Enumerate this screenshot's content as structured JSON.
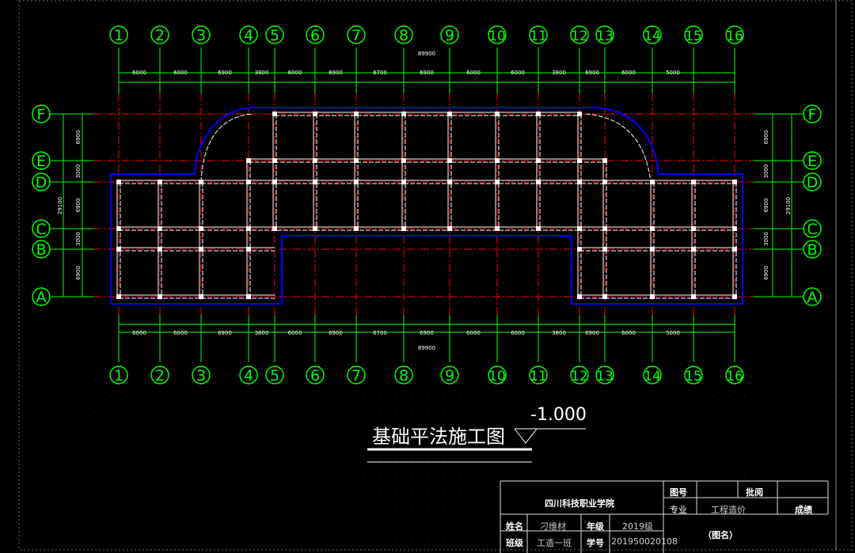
{
  "drawing": {
    "title": "基础平法施工图",
    "elevation": "-1.000"
  },
  "axes": {
    "numbers": [
      "1",
      "2",
      "3",
      "4",
      "5",
      "6",
      "7",
      "8",
      "9",
      "10",
      "11",
      "12",
      "13",
      "14",
      "15",
      "16"
    ],
    "letters": [
      "A",
      "B",
      "C",
      "D",
      "E",
      "F"
    ],
    "spans": [
      "6000",
      "6000",
      "6900",
      "3800",
      "6000",
      "6900",
      "6700",
      "6900",
      "6000",
      "6000",
      "3800",
      "6900",
      "6000",
      "5000"
    ],
    "total_length": "89900",
    "vertical_spans_left": [
      "6900",
      "3000",
      "6900",
      "3000",
      "6900"
    ],
    "vertical_total": "29100",
    "vertical_spans_right": [
      "6900",
      "3000",
      "6900",
      "3000",
      "6900"
    ]
  },
  "title_block": {
    "school": "四川科技职业学院",
    "drawing_no_label": "图号",
    "approve_label": "批阅",
    "major_label": "专业",
    "major_value": "工程造价",
    "grade_result_label": "成绩",
    "name_label": "姓名",
    "name_value": "刁维材",
    "year_label": "年级",
    "year_value": "2019级",
    "drawing_name": "（图名）",
    "class_label": "班级",
    "class_value": "工造一班",
    "student_no_label": "学号",
    "student_no_value": "201950020108"
  },
  "colors": {
    "background": "#000000",
    "axis_green": "#00ff00",
    "grid_red": "#ff0000",
    "outline_blue": "#0000ff",
    "beam_white": "#ffffff"
  }
}
